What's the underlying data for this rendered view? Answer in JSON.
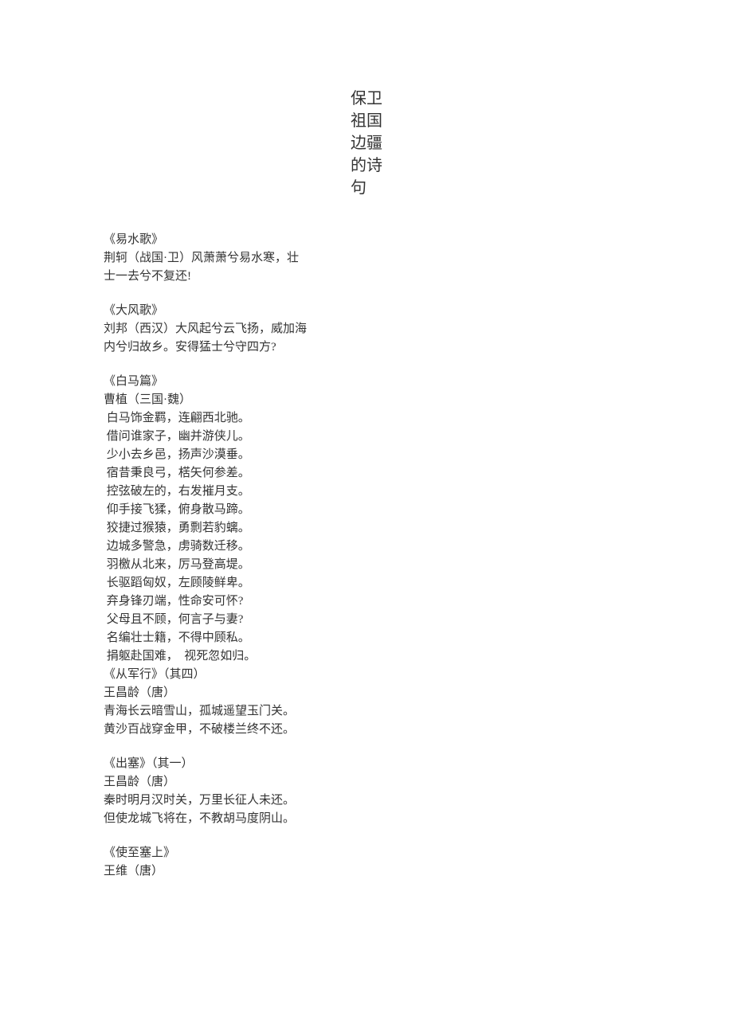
{
  "title": "保卫祖国边疆的诗句",
  "poems": [
    {
      "lines": [
        "《易水歌》",
        "荆轲（战国·卫）风萧萧兮易水寒，壮",
        "士一去兮不复还!"
      ]
    },
    {
      "lines": [
        "《大风歌》",
        "刘邦（西汉）大风起兮云飞扬，威加海",
        "内兮归故乡。安得猛士兮守四方?"
      ]
    },
    {
      "lines": [
        "《白马篇》",
        "曹植（三国·魏）",
        " 白马饰金羁，连翩西北驰。",
        " 借问谁家子，幽并游侠儿。",
        " 少小去乡邑，扬声沙漠垂。",
        " 宿昔秉良弓，楛矢何参差。",
        " 控弦破左的，右发摧月支。",
        " 仰手接飞猱，俯身散马蹄。",
        " 狡捷过猴猿，勇剽若豹螭。",
        " 边城多警急，虏骑数迁移。",
        " 羽檄从北来，厉马登高堤。",
        " 长驱蹈匈奴，左顾陵鲜卑。",
        " 弃身锋刃端，性命安可怀?",
        " 父母且不顾，何言子与妻?",
        " 名编壮士籍，不得中顾私。",
        " 捐躯赴国难，  视死忽如归。",
        "《从军行》（其四）",
        "王昌龄（唐）",
        "青海长云暗雪山，孤城遥望玉门关。",
        "黄沙百战穿金甲，不破楼兰终不还。"
      ]
    },
    {
      "lines": [
        "《出塞》（其一）",
        "王昌龄（唐）",
        "秦时明月汉时关，万里长征人未还。",
        "但使龙城飞将在，不教胡马度阴山。"
      ]
    },
    {
      "lines": [
        "《使至塞上》",
        "王维（唐）"
      ]
    }
  ]
}
